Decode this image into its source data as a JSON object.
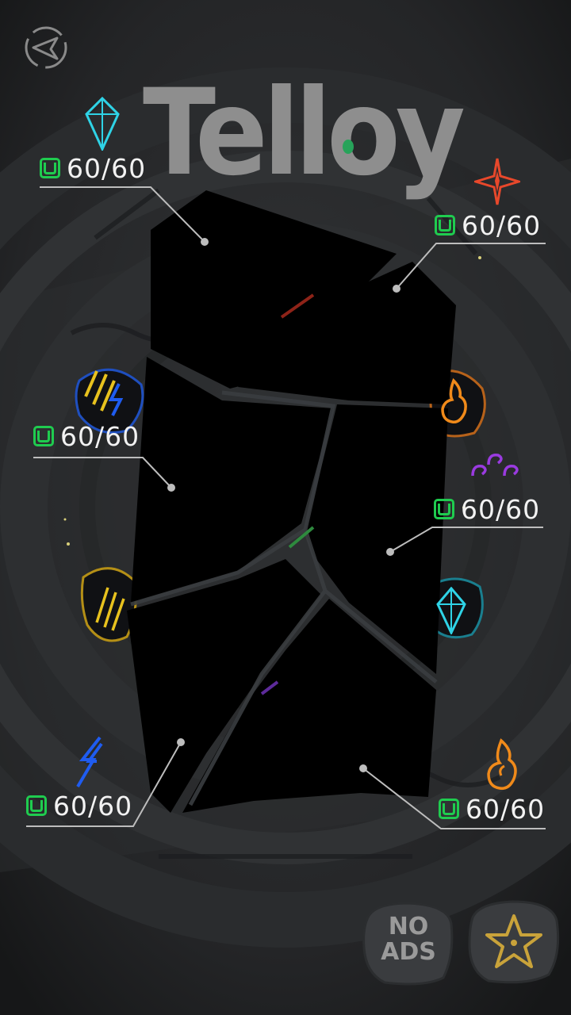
{
  "title": "Telloy",
  "regions": [
    {
      "id": "ice",
      "count": "60/60",
      "icon": "crystal-icon",
      "color": "#2fd3e6"
    },
    {
      "id": "fire",
      "count": "60/60",
      "icon": "star-burst-icon",
      "color": "#e8482b"
    },
    {
      "id": "storm",
      "count": "60/60",
      "icon": "claw-lightning-icon",
      "color": "#e8c21e"
    },
    {
      "id": "spirit",
      "count": "60/60",
      "icon": "swirl-icon",
      "color": "#9a3be0"
    },
    {
      "id": "lightning",
      "count": "60/60",
      "icon": "lightning-icon",
      "color": "#1f5cf0"
    },
    {
      "id": "flame",
      "count": "60/60",
      "icon": "flame-icon",
      "color": "#f08a1a"
    }
  ],
  "buttons": {
    "no_ads_line1": "NO",
    "no_ads_line2": "ADS",
    "back_icon": "back-arrow-icon",
    "rate_icon": "star-icon"
  },
  "colors": {
    "background": "#1c1d1f",
    "accent_green": "#1fcc4f",
    "title": "#8e8e8e"
  }
}
